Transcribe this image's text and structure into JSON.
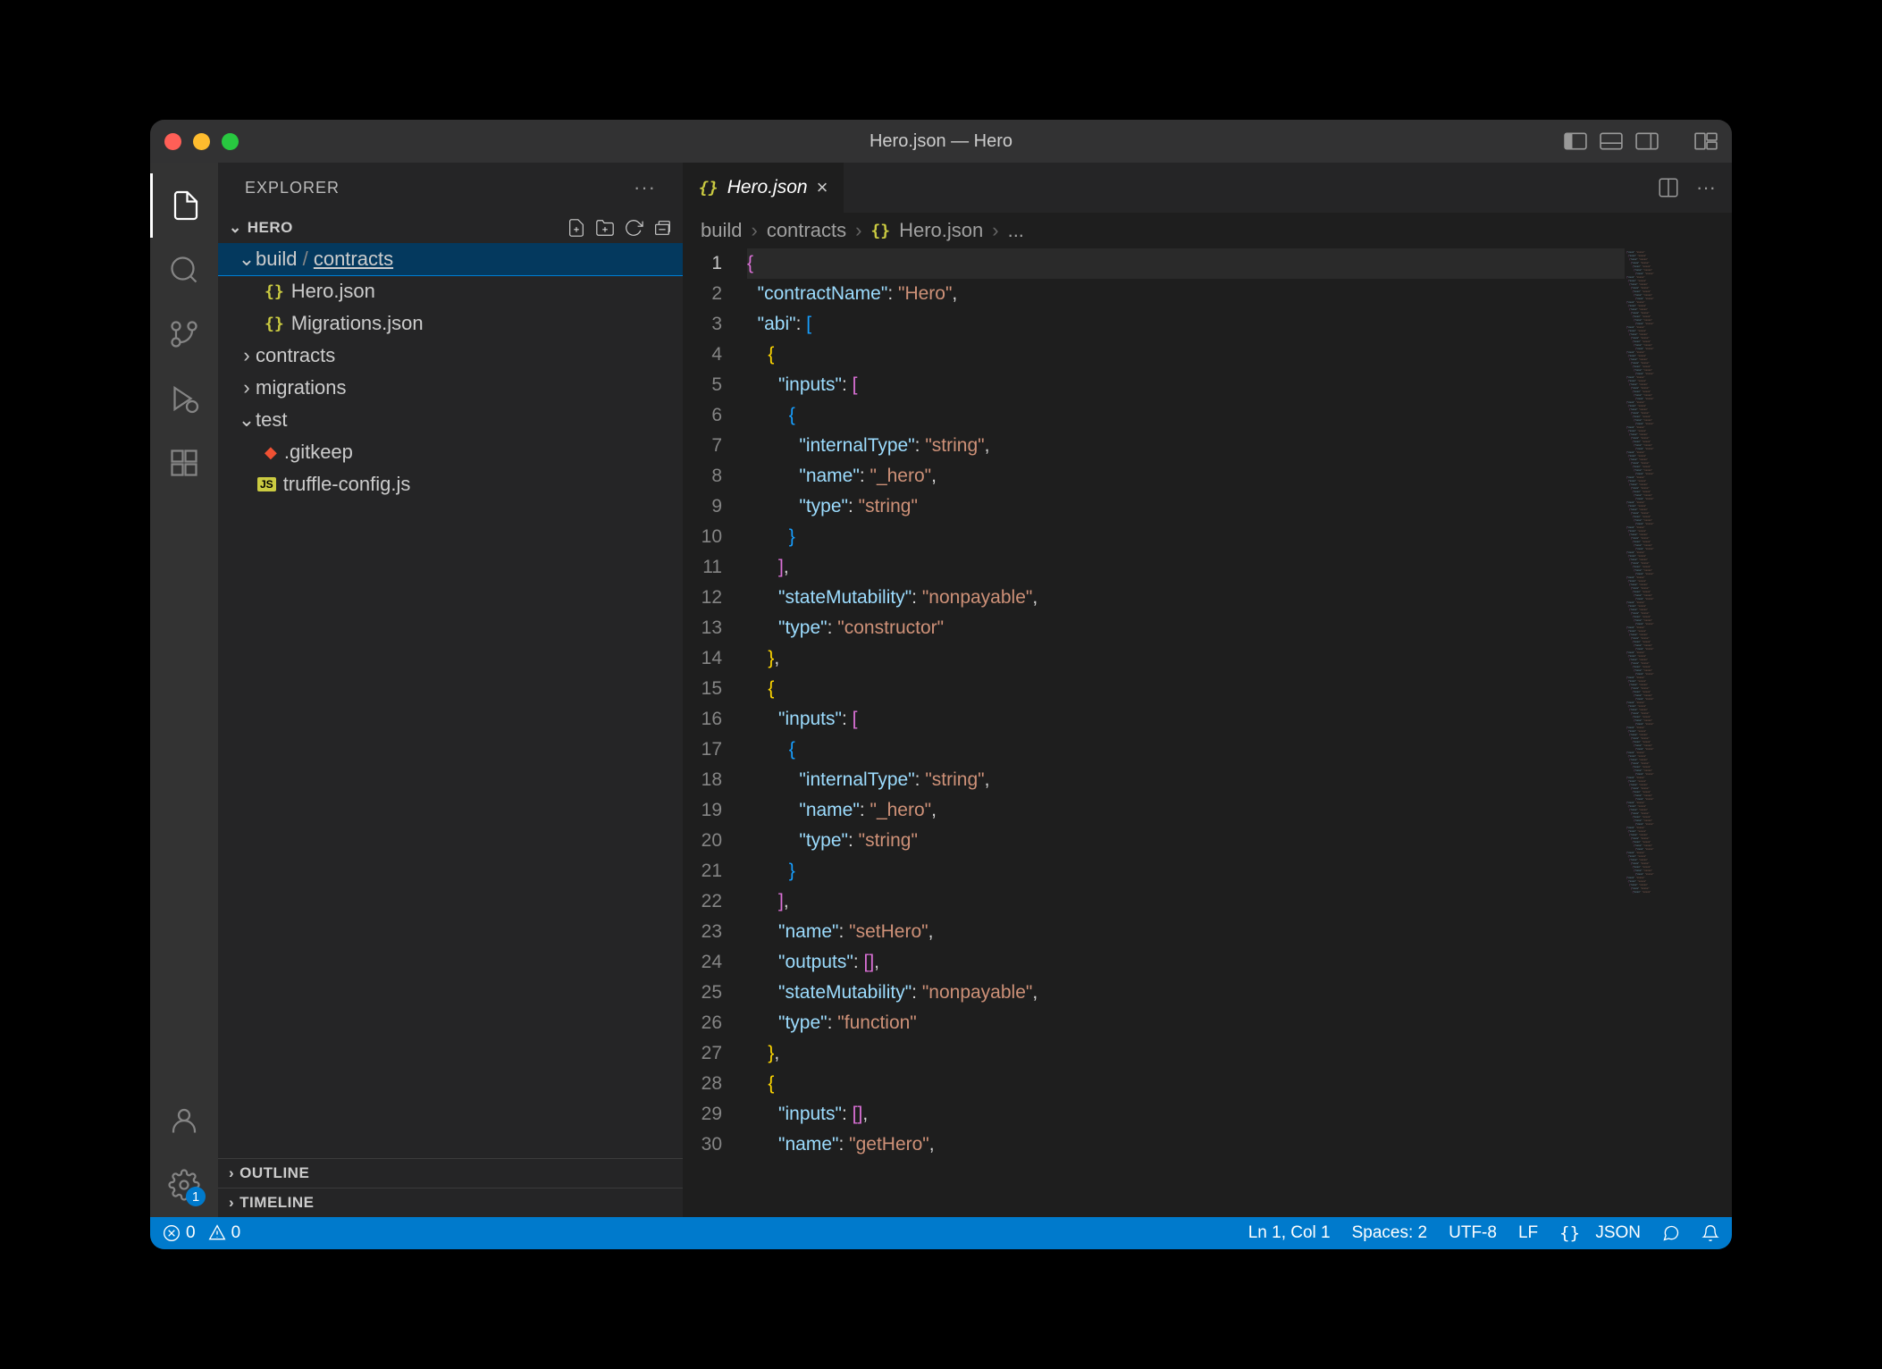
{
  "window": {
    "title": "Hero.json — Hero"
  },
  "sidebar": {
    "title": "EXPLORER",
    "project": "HERO",
    "tree": {
      "build": "build",
      "contracts_seg": "contracts",
      "hero_json": "Hero.json",
      "migrations_json": "Migrations.json",
      "contracts": "contracts",
      "migrations": "migrations",
      "test": "test",
      "gitkeep": ".gitkeep",
      "truffle_config": "truffle-config.js"
    },
    "outline": "OUTLINE",
    "timeline": "TIMELINE"
  },
  "tabs": {
    "active": "Hero.json"
  },
  "breadcrumbs": {
    "seg1": "build",
    "seg2": "contracts",
    "seg3": "Hero.json",
    "seg4": "..."
  },
  "activity": {
    "settings_badge": "1"
  },
  "code": {
    "lines": [
      {
        "n": 1,
        "tokens": [
          [
            "s-brace",
            "{"
          ]
        ]
      },
      {
        "n": 2,
        "tokens": [
          [
            "",
            "  "
          ],
          [
            "s-key",
            "\"contractName\""
          ],
          [
            "s-punct",
            ": "
          ],
          [
            "s-str",
            "\"Hero\""
          ],
          [
            "s-punct",
            ","
          ]
        ]
      },
      {
        "n": 3,
        "tokens": [
          [
            "",
            "  "
          ],
          [
            "s-key",
            "\"abi\""
          ],
          [
            "s-punct",
            ": "
          ],
          [
            "s-brace2",
            "["
          ]
        ]
      },
      {
        "n": 4,
        "tokens": [
          [
            "",
            "    "
          ],
          [
            "s-brace3",
            "{"
          ]
        ]
      },
      {
        "n": 5,
        "tokens": [
          [
            "",
            "      "
          ],
          [
            "s-key",
            "\"inputs\""
          ],
          [
            "s-punct",
            ": "
          ],
          [
            "s-brace",
            "["
          ]
        ]
      },
      {
        "n": 6,
        "tokens": [
          [
            "",
            "        "
          ],
          [
            "s-brace2",
            "{"
          ]
        ]
      },
      {
        "n": 7,
        "tokens": [
          [
            "",
            "          "
          ],
          [
            "s-key",
            "\"internalType\""
          ],
          [
            "s-punct",
            ": "
          ],
          [
            "s-str",
            "\"string\""
          ],
          [
            "s-punct",
            ","
          ]
        ]
      },
      {
        "n": 8,
        "tokens": [
          [
            "",
            "          "
          ],
          [
            "s-key",
            "\"name\""
          ],
          [
            "s-punct",
            ": "
          ],
          [
            "s-str",
            "\"_hero\""
          ],
          [
            "s-punct",
            ","
          ]
        ]
      },
      {
        "n": 9,
        "tokens": [
          [
            "",
            "          "
          ],
          [
            "s-key",
            "\"type\""
          ],
          [
            "s-punct",
            ": "
          ],
          [
            "s-str",
            "\"string\""
          ]
        ]
      },
      {
        "n": 10,
        "tokens": [
          [
            "",
            "        "
          ],
          [
            "s-brace2",
            "}"
          ]
        ]
      },
      {
        "n": 11,
        "tokens": [
          [
            "",
            "      "
          ],
          [
            "s-brace",
            "]"
          ],
          [
            "s-punct",
            ","
          ]
        ]
      },
      {
        "n": 12,
        "tokens": [
          [
            "",
            "      "
          ],
          [
            "s-key",
            "\"stateMutability\""
          ],
          [
            "s-punct",
            ": "
          ],
          [
            "s-str",
            "\"nonpayable\""
          ],
          [
            "s-punct",
            ","
          ]
        ]
      },
      {
        "n": 13,
        "tokens": [
          [
            "",
            "      "
          ],
          [
            "s-key",
            "\"type\""
          ],
          [
            "s-punct",
            ": "
          ],
          [
            "s-str",
            "\"constructor\""
          ]
        ]
      },
      {
        "n": 14,
        "tokens": [
          [
            "",
            "    "
          ],
          [
            "s-brace3",
            "}"
          ],
          [
            "s-punct",
            ","
          ]
        ]
      },
      {
        "n": 15,
        "tokens": [
          [
            "",
            "    "
          ],
          [
            "s-brace3",
            "{"
          ]
        ]
      },
      {
        "n": 16,
        "tokens": [
          [
            "",
            "      "
          ],
          [
            "s-key",
            "\"inputs\""
          ],
          [
            "s-punct",
            ": "
          ],
          [
            "s-brace",
            "["
          ]
        ]
      },
      {
        "n": 17,
        "tokens": [
          [
            "",
            "        "
          ],
          [
            "s-brace2",
            "{"
          ]
        ]
      },
      {
        "n": 18,
        "tokens": [
          [
            "",
            "          "
          ],
          [
            "s-key",
            "\"internalType\""
          ],
          [
            "s-punct",
            ": "
          ],
          [
            "s-str",
            "\"string\""
          ],
          [
            "s-punct",
            ","
          ]
        ]
      },
      {
        "n": 19,
        "tokens": [
          [
            "",
            "          "
          ],
          [
            "s-key",
            "\"name\""
          ],
          [
            "s-punct",
            ": "
          ],
          [
            "s-str",
            "\"_hero\""
          ],
          [
            "s-punct",
            ","
          ]
        ]
      },
      {
        "n": 20,
        "tokens": [
          [
            "",
            "          "
          ],
          [
            "s-key",
            "\"type\""
          ],
          [
            "s-punct",
            ": "
          ],
          [
            "s-str",
            "\"string\""
          ]
        ]
      },
      {
        "n": 21,
        "tokens": [
          [
            "",
            "        "
          ],
          [
            "s-brace2",
            "}"
          ]
        ]
      },
      {
        "n": 22,
        "tokens": [
          [
            "",
            "      "
          ],
          [
            "s-brace",
            "]"
          ],
          [
            "s-punct",
            ","
          ]
        ]
      },
      {
        "n": 23,
        "tokens": [
          [
            "",
            "      "
          ],
          [
            "s-key",
            "\"name\""
          ],
          [
            "s-punct",
            ": "
          ],
          [
            "s-str",
            "\"setHero\""
          ],
          [
            "s-punct",
            ","
          ]
        ]
      },
      {
        "n": 24,
        "tokens": [
          [
            "",
            "      "
          ],
          [
            "s-key",
            "\"outputs\""
          ],
          [
            "s-punct",
            ": "
          ],
          [
            "s-brace",
            "[]"
          ],
          [
            "s-punct",
            ","
          ]
        ]
      },
      {
        "n": 25,
        "tokens": [
          [
            "",
            "      "
          ],
          [
            "s-key",
            "\"stateMutability\""
          ],
          [
            "s-punct",
            ": "
          ],
          [
            "s-str",
            "\"nonpayable\""
          ],
          [
            "s-punct",
            ","
          ]
        ]
      },
      {
        "n": 26,
        "tokens": [
          [
            "",
            "      "
          ],
          [
            "s-key",
            "\"type\""
          ],
          [
            "s-punct",
            ": "
          ],
          [
            "s-str",
            "\"function\""
          ]
        ]
      },
      {
        "n": 27,
        "tokens": [
          [
            "",
            "    "
          ],
          [
            "s-brace3",
            "}"
          ],
          [
            "s-punct",
            ","
          ]
        ]
      },
      {
        "n": 28,
        "tokens": [
          [
            "",
            "    "
          ],
          [
            "s-brace3",
            "{"
          ]
        ]
      },
      {
        "n": 29,
        "tokens": [
          [
            "",
            "      "
          ],
          [
            "s-key",
            "\"inputs\""
          ],
          [
            "s-punct",
            ": "
          ],
          [
            "s-brace",
            "[]"
          ],
          [
            "s-punct",
            ","
          ]
        ]
      },
      {
        "n": 30,
        "tokens": [
          [
            "",
            "      "
          ],
          [
            "s-key",
            "\"name\""
          ],
          [
            "s-punct",
            ": "
          ],
          [
            "s-str",
            "\"getHero\""
          ],
          [
            "s-punct",
            ","
          ]
        ]
      }
    ]
  },
  "status": {
    "errors": "0",
    "warnings": "0",
    "ln_col": "Ln 1, Col 1",
    "spaces": "Spaces: 2",
    "encoding": "UTF-8",
    "eol": "LF",
    "lang": "JSON"
  }
}
